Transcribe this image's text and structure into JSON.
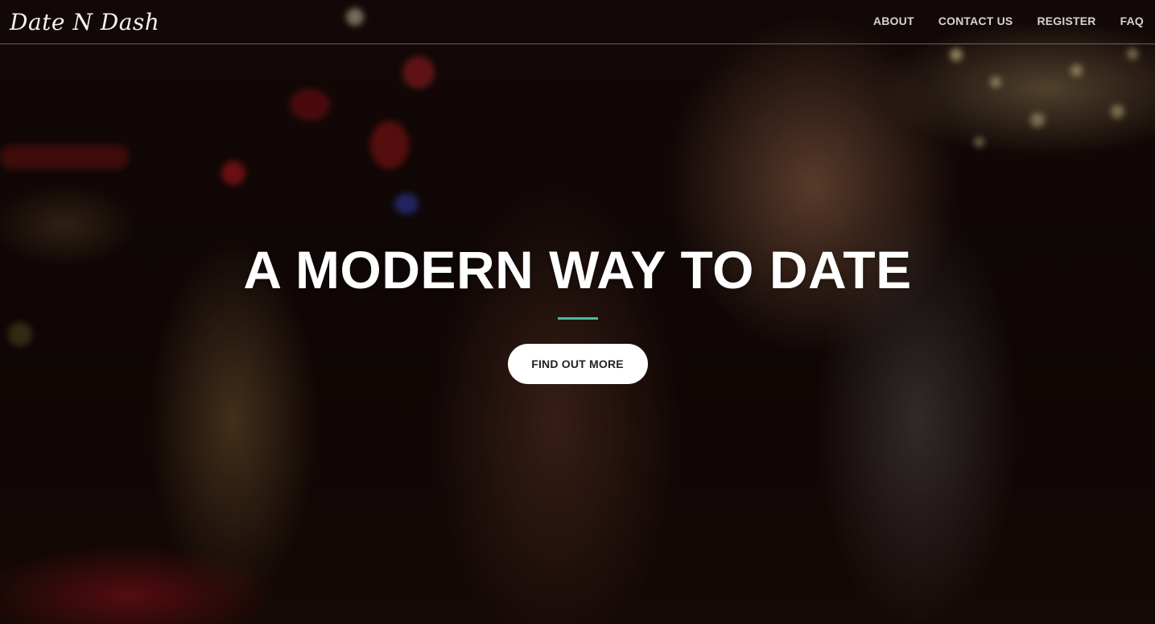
{
  "brand": {
    "name": "Date N Dash"
  },
  "nav": {
    "items": [
      {
        "label": "ABOUT"
      },
      {
        "label": "CONTACT US"
      },
      {
        "label": "REGISTER"
      },
      {
        "label": "FAQ"
      }
    ]
  },
  "hero": {
    "title": "A MODERN WAY TO DATE",
    "cta_label": "FIND OUT MORE",
    "accent_color": "#4fb8a0",
    "background_image": "couple-at-bar-photo"
  }
}
